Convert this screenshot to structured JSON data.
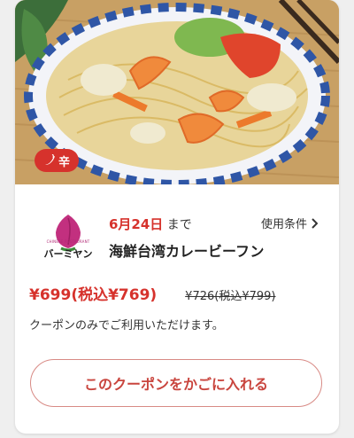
{
  "badge": {
    "label": "辛",
    "icon": "chili-pepper-icon",
    "color": "#d6322c"
  },
  "brand": {
    "name": "バーミヤン",
    "tagline": "CHINESE RESTAURANT"
  },
  "coupon": {
    "date": "6月24日",
    "date_suffix": "まで",
    "terms_label": "使用条件",
    "product_name": "海鮮台湾カレービーフン",
    "price": "¥699(税込¥769)",
    "original_price": "¥726(税込¥799)",
    "note": "クーポンのみでご利用いただけます。",
    "cta_label": "このクーポンをかごに入れる"
  },
  "colors": {
    "accent": "#d6322c",
    "cta_border": "#d88a85",
    "logo_pink": "#c2307f"
  }
}
